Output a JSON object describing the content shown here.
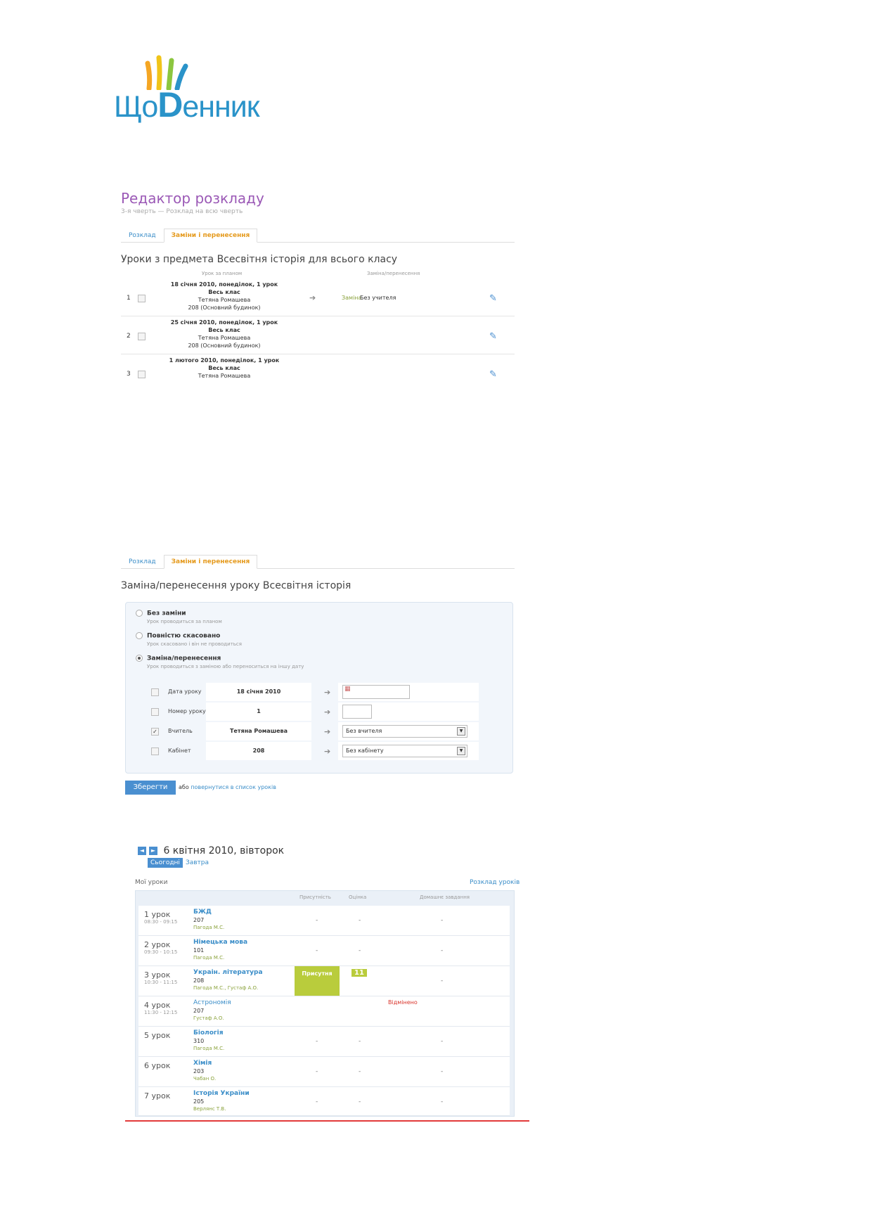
{
  "logo": {
    "text_left": "Що",
    "text_d": "D",
    "text_right": "енник"
  },
  "editor": {
    "title": "Редактор розкладу",
    "subtitle": "3-я чверть — Розклад на всю чверть",
    "tabs": [
      {
        "label": "Розклад"
      },
      {
        "label": "Заміни і перенесення"
      }
    ],
    "heading": "Уроки з предмета Всесвітня історія для всього класу",
    "col_lesson": "Урок за планом",
    "col_change": "Заміна/перенесення",
    "rows": [
      {
        "num": "1",
        "date": "18 січня 2010, понеділок, 1 урок",
        "group": "Весь клас",
        "teacher": "Тетяна Ромашева",
        "room": "208 (Основний будинок)",
        "change_type": "Заміна",
        "change_value": "Без учителя"
      },
      {
        "num": "2",
        "date": "25 січня 2010, понеділок, 1 урок",
        "group": "Весь клас",
        "teacher": "Тетяна Ромашева",
        "room": "208 (Основний будинок)",
        "change_type": "",
        "change_value": ""
      },
      {
        "num": "3",
        "date": "1 лютого 2010, понеділок, 1 урок",
        "group": "Весь клас",
        "teacher": "Тетяна Ромашева",
        "room": "",
        "change_type": "",
        "change_value": ""
      }
    ]
  },
  "change_form": {
    "tabs": [
      {
        "label": "Розклад"
      },
      {
        "label": "Заміни і перенесення"
      }
    ],
    "heading": "Заміна/перенесення уроку Всесвітня історія",
    "options": [
      {
        "label": "Без заміни",
        "desc": "Урок проводиться за планом",
        "selected": false
      },
      {
        "label": "Повністю скасовано",
        "desc": "Урок скасовано і він не проводиться",
        "selected": false
      },
      {
        "label": "Заміна/перенесення",
        "desc": "Урок проводиться з заміною або переноситься на іншу дату",
        "selected": true
      }
    ],
    "fields": [
      {
        "label": "Дата уроку",
        "value": "18 січня 2010",
        "checked": false,
        "new_value": ""
      },
      {
        "label": "Номер уроку",
        "value": "1",
        "checked": false,
        "new_value": ""
      },
      {
        "label": "Вчитель",
        "value": "Тетяна Ромашева",
        "checked": true,
        "new_value": "Без вчителя"
      },
      {
        "label": "Кабінет",
        "value": "208",
        "checked": false,
        "new_value": "Без кабінету"
      }
    ],
    "save_label": "Зберегти",
    "or_text": "або",
    "back_link": "повернутися в список уроків"
  },
  "diary": {
    "date_title": "6 квітня 2010, вівторок",
    "prev_icon": "◄",
    "next_icon": "►",
    "today_label": "Сьогодні",
    "tomorrow_label": "Завтра",
    "my_lessons": "Мої уроки",
    "schedule_link": "Розклад уроків",
    "col_presence": "Присутність",
    "col_grade": "Оцінка",
    "col_homework": "Домашнє завдання",
    "lessons": [
      {
        "num": "1 урок",
        "time": "08:30 - 09:15",
        "subject": "БЖД",
        "room": "207",
        "teacher": "Пагода М.С.",
        "presence": "-",
        "grade": "-",
        "homework": "-"
      },
      {
        "num": "2 урок",
        "time": "09:30 - 10:15",
        "subject": "Німецька мова",
        "room": "101",
        "teacher": "Пагода М.С.",
        "presence": "-",
        "grade": "-",
        "homework": "-"
      },
      {
        "num": "3 урок",
        "time": "10:30 - 11:15",
        "subject": "Украін. література",
        "room": "208",
        "teacher": "Пагода М.С., Густаф А.О.",
        "presence": "Присутня",
        "grade": "11",
        "homework": "-"
      },
      {
        "num": "4 урок",
        "time": "11:30 - 12:15",
        "subject": "Астрономія",
        "room": "207",
        "teacher": "Густаф А.О.",
        "presence": "",
        "grade": "",
        "homework": "Відмінено"
      },
      {
        "num": "5 урок",
        "time": "",
        "subject": "Біологія",
        "room": "310",
        "teacher": "Пагода М.С.",
        "presence": "-",
        "grade": "-",
        "homework": "-"
      },
      {
        "num": "6 урок",
        "time": "",
        "subject": "Хімія",
        "room": "203",
        "teacher": "Чабан О.",
        "presence": "-",
        "grade": "-",
        "homework": "-"
      },
      {
        "num": "7 урок",
        "time": "",
        "subject": "Історія України",
        "room": "205",
        "teacher": "Верлянс Т.В.",
        "presence": "-",
        "grade": "-",
        "homework": "-"
      }
    ]
  }
}
